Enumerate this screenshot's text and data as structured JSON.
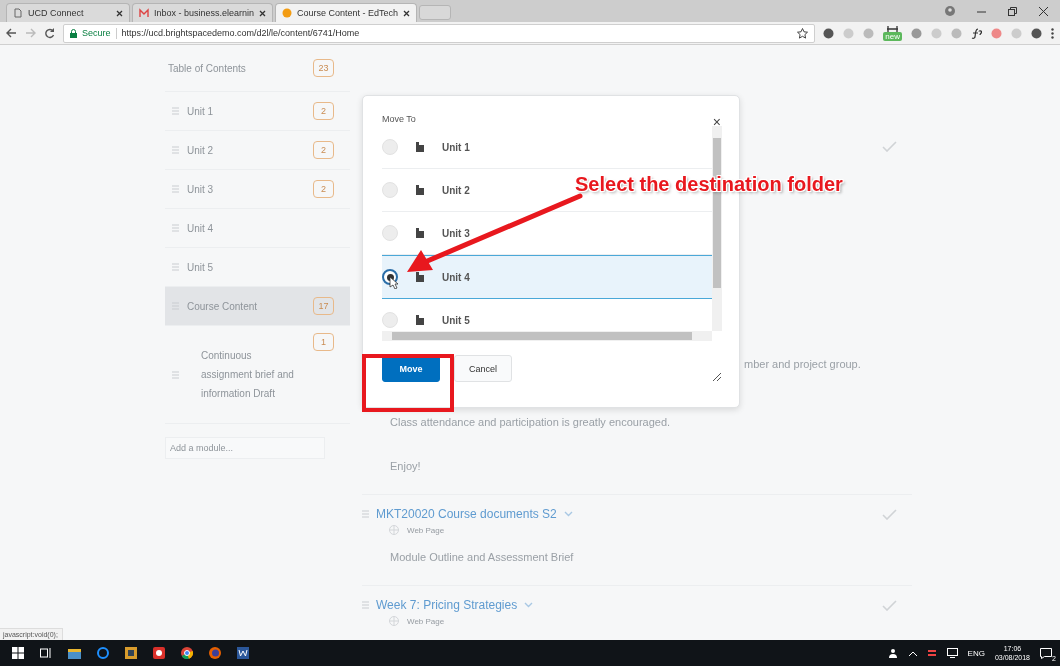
{
  "browser": {
    "tabs": [
      {
        "title": "UCD Connect",
        "selected": false
      },
      {
        "title": "Inbox - business.elearnin",
        "selected": false
      },
      {
        "title": "Course Content - EdTech",
        "selected": true
      }
    ],
    "secure_label": "Secure",
    "url": "https://ucd.brightspacedemo.com/d2l/le/content/6741/Home",
    "extension_badge": "new"
  },
  "sidebar": {
    "items": [
      {
        "kind": "heading",
        "label": "Table of Contents",
        "count": "23",
        "selected": false
      },
      {
        "kind": "module",
        "label": "Unit 1",
        "count": "2",
        "selected": false
      },
      {
        "kind": "module",
        "label": "Unit 2",
        "count": "2",
        "selected": false
      },
      {
        "kind": "module",
        "label": "Unit 3",
        "count": "2",
        "selected": false
      },
      {
        "kind": "module",
        "label": "Unit 4",
        "selected": false
      },
      {
        "kind": "module",
        "label": "Unit 5",
        "selected": false
      },
      {
        "kind": "module",
        "label": "Course Content",
        "count": "17",
        "selected": true
      },
      {
        "kind": "submodule",
        "label": "Continuous assignment brief and information Draft",
        "count": "1",
        "selected": false
      }
    ],
    "add_placeholder": "Add a module..."
  },
  "content": {
    "partial_text": "mber and project group.",
    "paragraphs": [
      "Class attendance and participation is greatly encouraged.",
      "Enjoy!"
    ],
    "topics": [
      {
        "title": "MKT20020 Course documents S2",
        "type": "Web Page",
        "description": "Module Outline and Assessment Brief"
      },
      {
        "title": "Week 7: Pricing Strategies",
        "type": "Web Page"
      }
    ]
  },
  "dialog": {
    "title": "Move To",
    "close": "×",
    "options": [
      {
        "label": "Unit 1",
        "selected": false
      },
      {
        "label": "Unit 2",
        "selected": false
      },
      {
        "label": "Unit 3",
        "selected": false
      },
      {
        "label": "Unit 4",
        "selected": true
      },
      {
        "label": "Unit 5",
        "selected": false
      }
    ],
    "buttons": [
      {
        "label": "Move",
        "kind": "primary"
      },
      {
        "label": "Cancel",
        "kind": "secondary"
      }
    ]
  },
  "annotation": {
    "text": "Select the destination folder"
  },
  "status_text": "javascript:void(0);",
  "taskbar": {
    "language": "ENG",
    "time": "17:06",
    "date": "03/08/2018",
    "notification_count": "2"
  }
}
